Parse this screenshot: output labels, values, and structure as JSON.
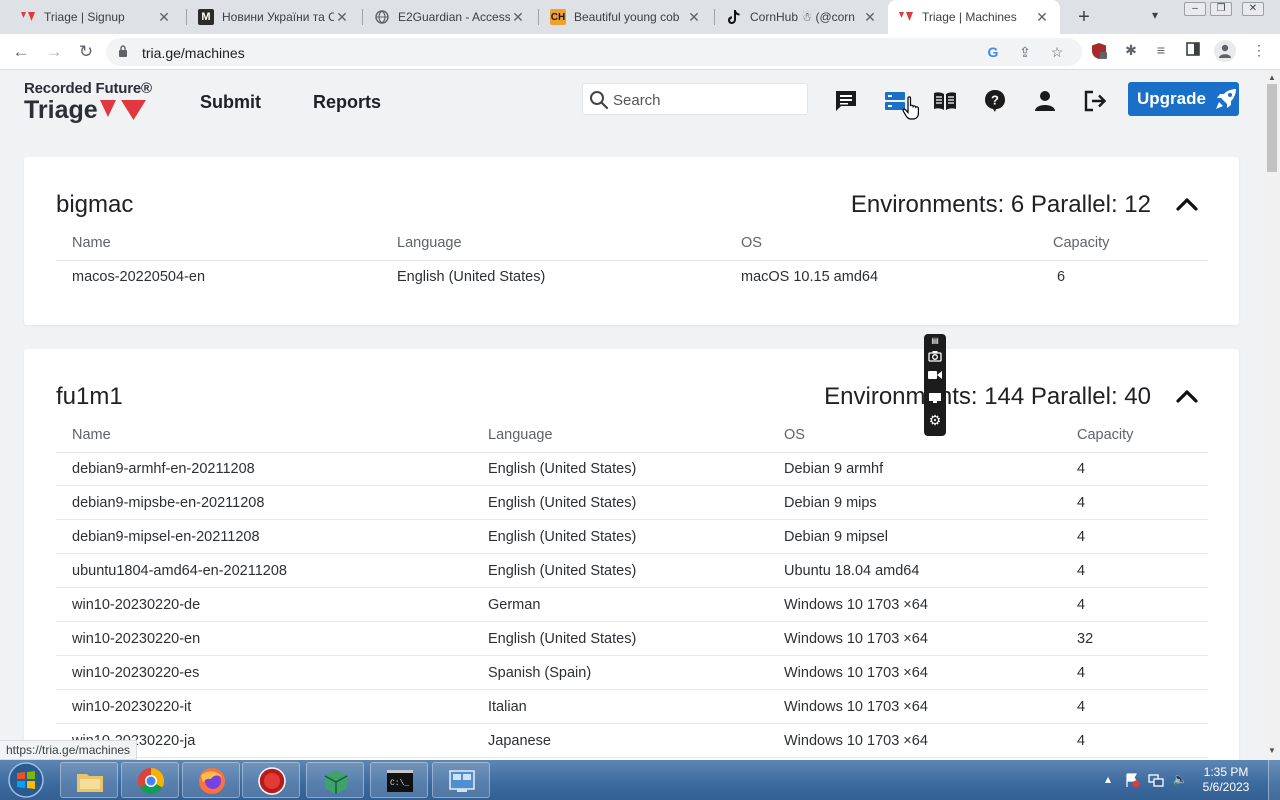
{
  "browser": {
    "tabs": [
      {
        "title": "Triage | Signup",
        "icon": "triage-icon"
      },
      {
        "title": "Новини України та С",
        "icon": "news-m-icon"
      },
      {
        "title": "E2Guardian - Access",
        "icon": "globe-icon"
      },
      {
        "title": "Beautiful young cob",
        "icon": "ch-icon"
      },
      {
        "title": "CornHub ☃ (@corn",
        "icon": "tiktok-icon"
      },
      {
        "title": "Triage | Machines",
        "icon": "triage-icon",
        "active": true
      }
    ],
    "url": "tria.ge/machines",
    "status_url": "https://tria.ge/machines"
  },
  "header": {
    "logo_top": "Recorded Future®",
    "logo_main": "Triage",
    "nav": [
      "Submit",
      "Reports"
    ],
    "search_placeholder": "Search",
    "upgrade_label": "Upgrade",
    "icons": [
      "chat-icon",
      "machines-icon",
      "book-icon",
      "help-icon",
      "user-icon",
      "logout-icon"
    ]
  },
  "columns": [
    "Name",
    "Language",
    "OS",
    "Capacity"
  ],
  "groups": [
    {
      "name": "bigmac",
      "stats": "Environments: 6 Parallel: 12",
      "rows": [
        [
          "macos-20220504-en",
          "English (United States)",
          "macOS 10.15 amd64",
          "6"
        ]
      ]
    },
    {
      "name": "fu1m1",
      "stats": "Environments: 144 Parallel: 40",
      "rows": [
        [
          "debian9-armhf-en-20211208",
          "English (United States)",
          "Debian 9 armhf",
          "4"
        ],
        [
          "debian9-mipsbe-en-20211208",
          "English (United States)",
          "Debian 9 mips",
          "4"
        ],
        [
          "debian9-mipsel-en-20211208",
          "English (United States)",
          "Debian 9 mipsel",
          "4"
        ],
        [
          "ubuntu1804-amd64-en-20211208",
          "English (United States)",
          "Ubuntu 18.04 amd64",
          "4"
        ],
        [
          "win10-20230220-de",
          "German",
          "Windows 10 1703 ×64",
          "4"
        ],
        [
          "win10-20230220-en",
          "English (United States)",
          "Windows 10 1703 ×64",
          "32"
        ],
        [
          "win10-20230220-es",
          "Spanish (Spain)",
          "Windows 10 1703 ×64",
          "4"
        ],
        [
          "win10-20230220-it",
          "Italian",
          "Windows 10 1703 ×64",
          "4"
        ],
        [
          "win10-20230220-ja",
          "Japanese",
          "Windows 10 1703 ×64",
          "4"
        ]
      ]
    }
  ],
  "taskbar": {
    "time": "1:35 PM",
    "date": "5/6/2023"
  },
  "colors": {
    "accent": "#1a6fc9",
    "brand_red": "#e0383e",
    "page_bg": "#f1f2f4"
  }
}
